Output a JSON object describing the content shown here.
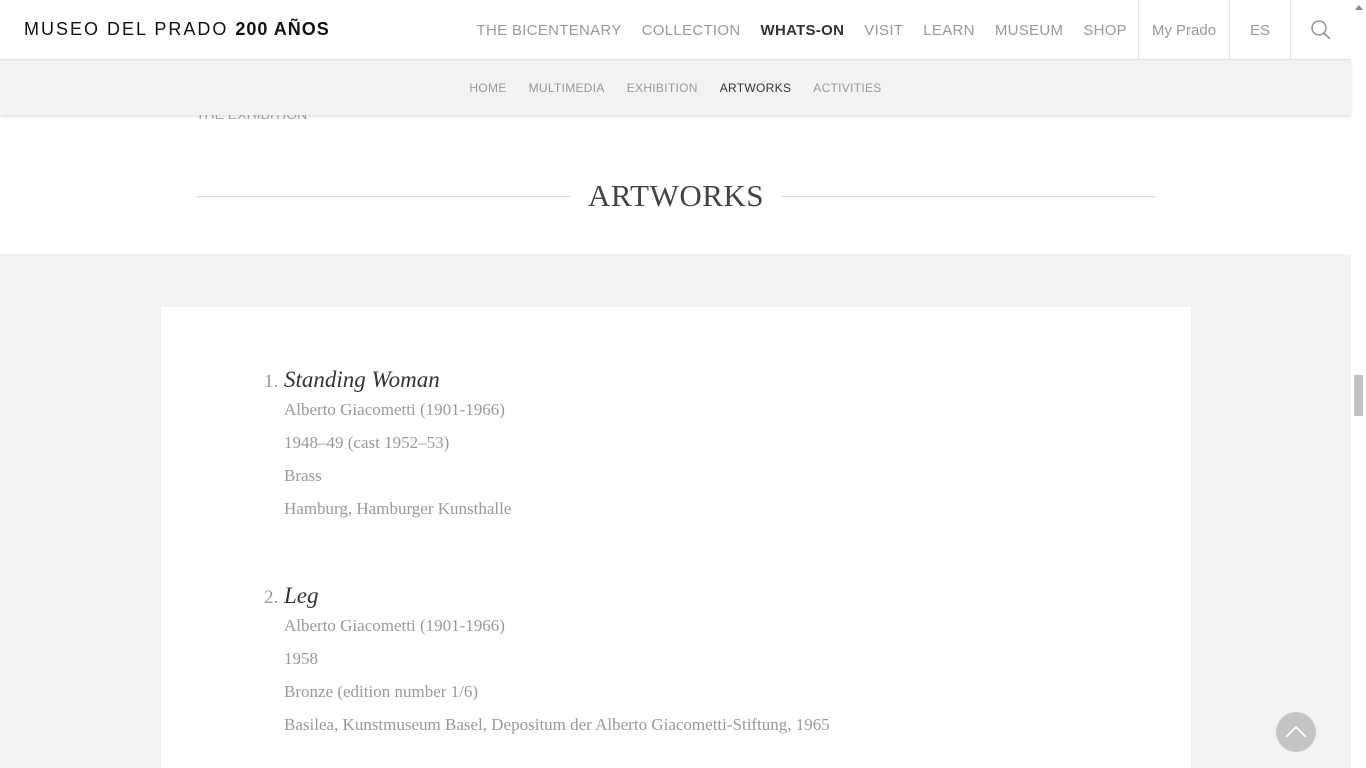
{
  "header": {
    "logo_light": "MUSEO DEL PRADO",
    "logo_bold": "200 AÑOS",
    "nav": [
      "THE BICENTENARY",
      "COLLECTION",
      "WHATS-ON",
      "VISIT",
      "LEARN",
      "MUSEUM",
      "SHOP"
    ],
    "active_nav": "WHATS-ON",
    "my_prado": "My Prado",
    "lang": "ES",
    "search_icon": "search-icon"
  },
  "subnav": {
    "items": [
      "HOME",
      "MULTIMEDIA",
      "EXHIBITION",
      "ARTWORKS",
      "ACTIVITIES"
    ],
    "active": "ARTWORKS"
  },
  "breadcrumb": "THE EXHIBITION",
  "section_title": "ARTWORKS",
  "artworks": [
    {
      "num": "1.",
      "title": "Standing Woman",
      "artist": "Alberto Giacometti (1901-1966)",
      "date": "1948–49 (cast 1952–53)",
      "medium": "Brass",
      "location": "Hamburg, Hamburger Kunsthalle"
    },
    {
      "num": "2.",
      "title": "Leg",
      "artist": "Alberto Giacometti (1901-1966)",
      "date": "1958",
      "medium": "Bronze (edition number 1/6)",
      "location": "Basilea, Kunstmuseum Basel, Depositum der Alberto Giacometti-Stiftung, 1965"
    }
  ]
}
